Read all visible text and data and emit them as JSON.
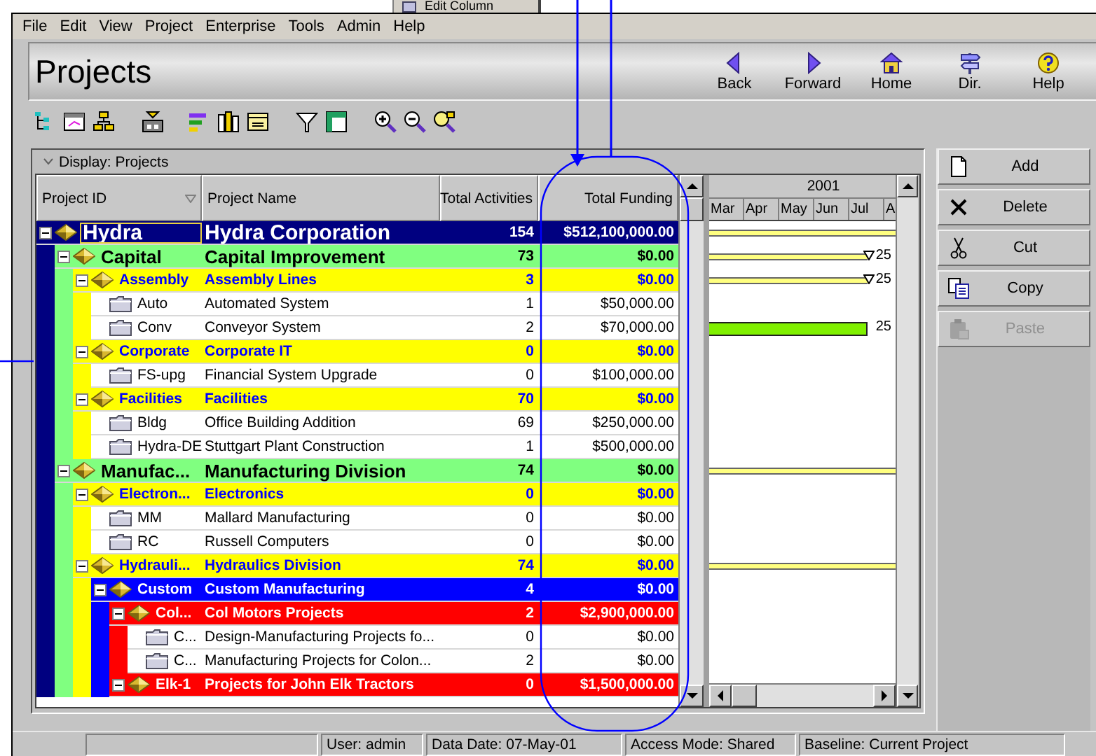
{
  "menu_fragment": {
    "label": "Edit Column"
  },
  "menu_bar": [
    "File",
    "Edit",
    "View",
    "Project",
    "Enterprise",
    "Tools",
    "Admin",
    "Help"
  ],
  "header": {
    "title": "Projects",
    "nav_buttons": [
      {
        "label": "Back",
        "kind": "back"
      },
      {
        "label": "Forward",
        "kind": "forward"
      },
      {
        "label": "Home",
        "kind": "home"
      },
      {
        "label": "Dir.",
        "kind": "directory"
      },
      {
        "label": "Help",
        "kind": "help"
      }
    ]
  },
  "display_bar": {
    "label": "Display: Projects"
  },
  "table": {
    "columns": [
      {
        "label": "Project ID",
        "sorted": true
      },
      {
        "label": "Project Name",
        "sorted": false
      },
      {
        "label": "Total Activities",
        "sorted": false
      },
      {
        "label": "Total Funding",
        "sorted": false
      }
    ],
    "rows": [
      {
        "id": "Hydra",
        "name": "Hydra Corporation",
        "activities": "154",
        "funding": "$512,100,000.00",
        "kind": "eps",
        "color": "#000080",
        "expanded": true,
        "selected": true,
        "bar": {
          "kind": "summary"
        },
        "children": [
          {
            "id": "Capital",
            "name": "Capital Improvement",
            "activities": "73",
            "funding": "$0.00",
            "kind": "eps",
            "color": "#80ff80",
            "expanded": true,
            "selected": false,
            "bar": {
              "kind": "summary_end",
              "label": "25"
            },
            "children": [
              {
                "id": "Assembly",
                "name": "Assembly Lines",
                "activities": "3",
                "funding": "$0.00",
                "kind": "eps",
                "color": "#ffff00",
                "expanded": true,
                "selected": false,
                "bar": {
                  "kind": "summary_end",
                  "label": "25"
                },
                "children": [
                  {
                    "id": "Auto",
                    "name": "Automated System",
                    "activities": "1",
                    "funding": "$50,000.00",
                    "kind": "project",
                    "selected": false
                  },
                  {
                    "id": "Conv",
                    "name": "Conveyor System",
                    "activities": "2",
                    "funding": "$70,000.00",
                    "kind": "project",
                    "selected": false,
                    "bar": {
                      "kind": "activity",
                      "label": "25"
                    }
                  }
                ]
              },
              {
                "id": "Corporate",
                "name": "Corporate IT",
                "activities": "0",
                "funding": "$0.00",
                "kind": "eps",
                "color": "#ffff00",
                "expanded": true,
                "selected": false,
                "children": [
                  {
                    "id": "FS-upg",
                    "name": "Financial System Upgrade",
                    "activities": "0",
                    "funding": "$100,000.00",
                    "kind": "project",
                    "selected": false
                  }
                ]
              },
              {
                "id": "Facilities",
                "name": "Facilities",
                "activities": "70",
                "funding": "$0.00",
                "kind": "eps",
                "color": "#ffff00",
                "expanded": true,
                "selected": false,
                "children": [
                  {
                    "id": "Bldg",
                    "name": "Office Building Addition",
                    "activities": "69",
                    "funding": "$250,000.00",
                    "kind": "project",
                    "selected": false
                  },
                  {
                    "id": "Hydra-DE",
                    "name": "Stuttgart Plant Construction",
                    "activities": "1",
                    "funding": "$500,000.00",
                    "kind": "project",
                    "selected": false
                  }
                ]
              }
            ]
          },
          {
            "id": "Manufac...",
            "name": "Manufacturing Division",
            "activities": "74",
            "funding": "$0.00",
            "kind": "eps",
            "color": "#80ff80",
            "expanded": true,
            "selected": false,
            "bar": {
              "kind": "summary"
            },
            "children": [
              {
                "id": "Electron...",
                "name": "Electronics",
                "activities": "0",
                "funding": "$0.00",
                "kind": "eps",
                "color": "#ffff00",
                "expanded": true,
                "selected": false,
                "children": [
                  {
                    "id": "MM",
                    "name": "Mallard Manufacturing",
                    "activities": "0",
                    "funding": "$0.00",
                    "kind": "project",
                    "selected": false
                  },
                  {
                    "id": "RC",
                    "name": "Russell Computers",
                    "activities": "0",
                    "funding": "$0.00",
                    "kind": "project",
                    "selected": false
                  }
                ]
              },
              {
                "id": "Hydrauli...",
                "name": "Hydraulics Division",
                "activities": "74",
                "funding": "$0.00",
                "kind": "eps",
                "color": "#ffff00",
                "expanded": true,
                "selected": false,
                "bar": {
                  "kind": "summary"
                },
                "children": [
                  {
                    "id": "Custom",
                    "name": "Custom Manufacturing",
                    "activities": "4",
                    "funding": "$0.00",
                    "kind": "eps",
                    "color": "#0000ff",
                    "expanded": true,
                    "selected": false,
                    "children": [
                      {
                        "id": "Col...",
                        "name": "Col Motors Projects",
                        "activities": "2",
                        "funding": "$2,900,000.00",
                        "kind": "eps",
                        "color": "#ff0000",
                        "expanded": true,
                        "selected": false,
                        "children": [
                          {
                            "id": "C...",
                            "name": "Design-Manufacturing Projects fo...",
                            "activities": "0",
                            "funding": "$0.00",
                            "kind": "project",
                            "selected": false
                          },
                          {
                            "id": "C...",
                            "name": "Manufacturing Projects for Colon...",
                            "activities": "2",
                            "funding": "$0.00",
                            "kind": "project",
                            "selected": false
                          }
                        ]
                      },
                      {
                        "id": "Elk-1",
                        "name": "Projects for John Elk Tractors",
                        "activities": "0",
                        "funding": "$1,500,000.00",
                        "kind": "eps",
                        "color": "#ff0000",
                        "expanded": true,
                        "selected": false
                      }
                    ]
                  }
                ]
              }
            ]
          }
        ]
      }
    ]
  },
  "gantt": {
    "year": "2001",
    "months": [
      "Mar",
      "Apr",
      "May",
      "Jun",
      "Jul",
      "A"
    ]
  },
  "actions": [
    {
      "label": "Add",
      "kind": "add",
      "disabled": false
    },
    {
      "label": "Delete",
      "kind": "delete",
      "disabled": false
    },
    {
      "label": "Cut",
      "kind": "cut",
      "disabled": false
    },
    {
      "label": "Copy",
      "kind": "copy",
      "disabled": false
    },
    {
      "label": "Paste",
      "kind": "paste",
      "disabled": true
    }
  ],
  "status_bar": [
    "User: admin",
    "Data Date: 07-May-01",
    "Access Mode: Shared",
    "Baseline: Current Project"
  ]
}
